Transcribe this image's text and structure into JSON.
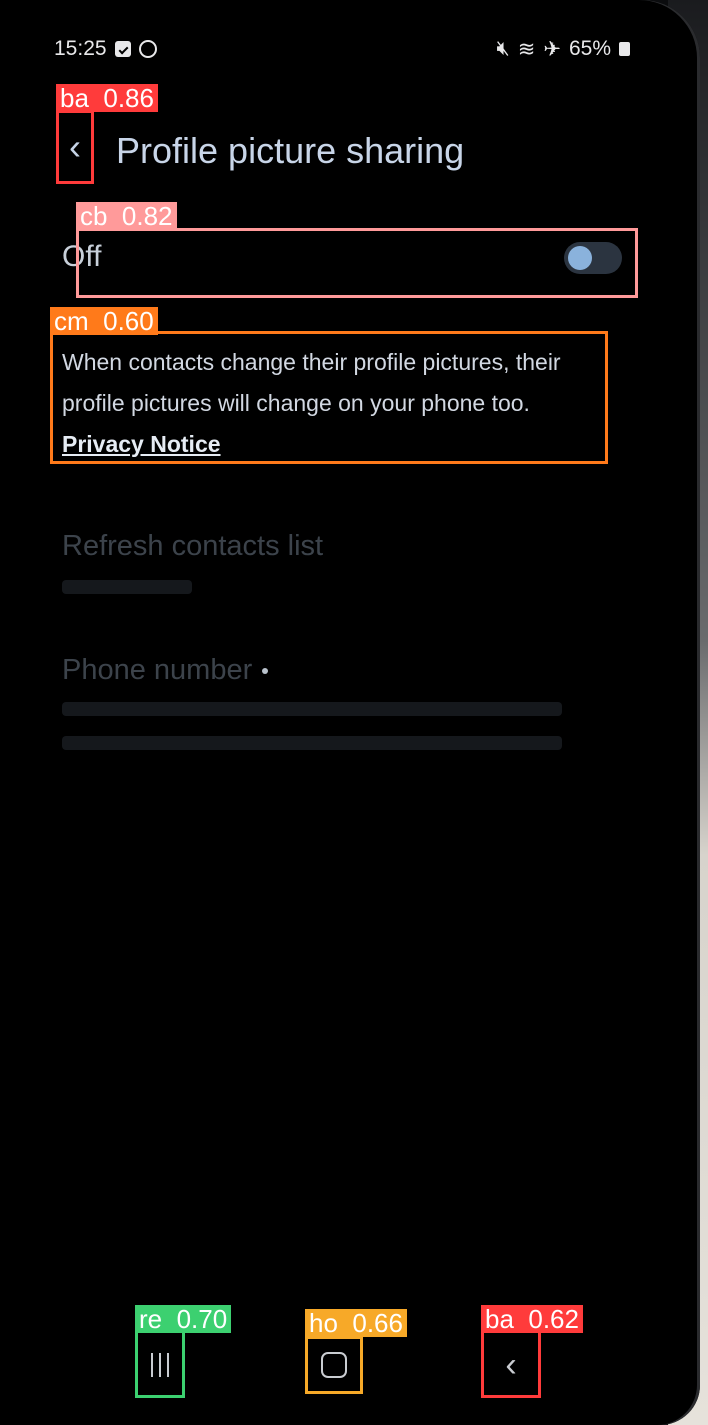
{
  "status_bar": {
    "time": "15:25",
    "battery": "65%",
    "icons": [
      "check-square-icon",
      "messenger-icon",
      "mute-icon",
      "wifi-icon",
      "airplane-icon",
      "battery-icon"
    ]
  },
  "header": {
    "title": "Profile picture sharing",
    "back_icon": "chevron-left-icon"
  },
  "toggle": {
    "label": "Off",
    "state": false
  },
  "description": {
    "text": "When contacts change their profile pictures, their profile pictures will change on your phone too.",
    "link": "Privacy Notice"
  },
  "disabled_items": [
    {
      "title": "Refresh contacts list"
    },
    {
      "title": "Phone number"
    }
  ],
  "nav_bar": {
    "recent_icon": "recents-icon",
    "home_icon": "home-icon",
    "back_icon": "back-icon"
  },
  "annotations": [
    {
      "label": "ba  0.86",
      "color": "#ff3b3b"
    },
    {
      "label": "cb  0.82",
      "color": "#ff9a9a"
    },
    {
      "label": "cm  0.60",
      "color": "#ff7a1a"
    },
    {
      "label": "re  0.70",
      "color": "#3cd070"
    },
    {
      "label": "ho  0.66",
      "color": "#f7a928"
    },
    {
      "label": "ba  0.62",
      "color": "#ff3b3b"
    }
  ]
}
